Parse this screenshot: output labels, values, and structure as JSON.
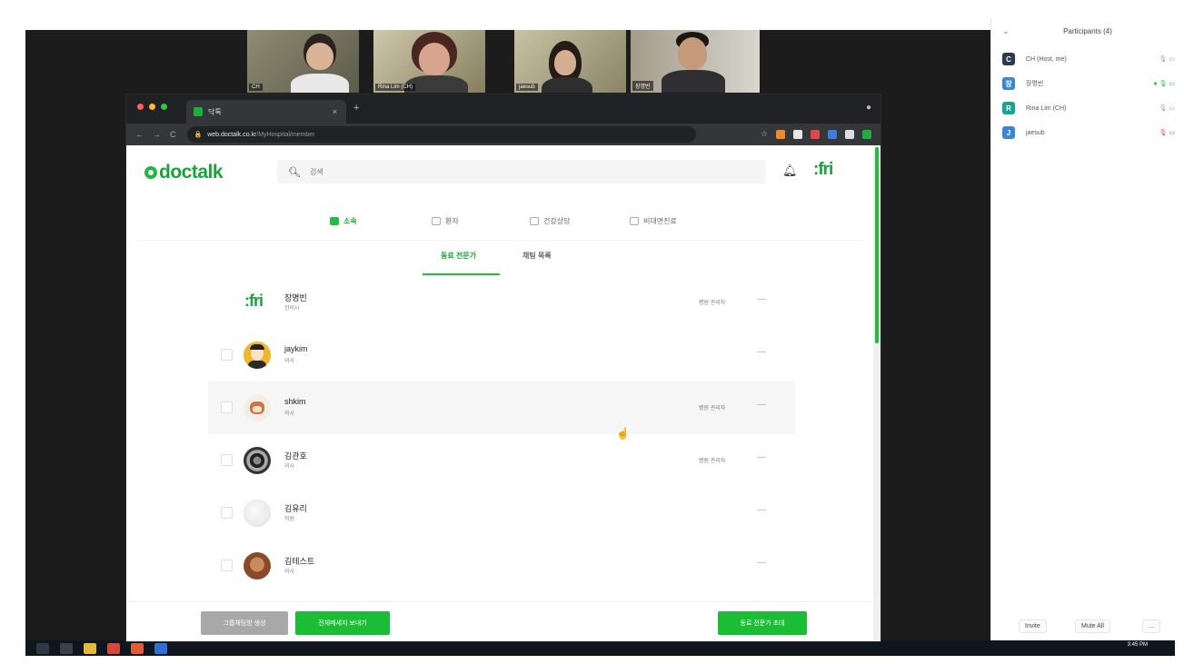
{
  "zoom": {
    "participants_title": "Participants (4)",
    "collapse_label": "⌄",
    "participants": [
      {
        "initial": "C",
        "name": "CH (Host, me)",
        "color": "#2c3a4f",
        "icons": "🎙 ▭"
      },
      {
        "initial": "장",
        "name": "장명빈",
        "color": "#3a86d6",
        "icons": "● 🎙 ▭"
      },
      {
        "initial": "R",
        "name": "Rina Lim (CH)",
        "color": "#1ba38f",
        "icons": "🎙 ▭"
      },
      {
        "initial": "J",
        "name": "jaesub",
        "color": "#3a86d6",
        "icons": "🎙 ▭"
      }
    ],
    "buttons": {
      "invite": "Invite",
      "mute_all": "Mute All",
      "more": "..."
    },
    "video_names": [
      "CH",
      "Rina Lim (CH)",
      "jaesub",
      "장명빈"
    ]
  },
  "browser": {
    "tab_title": "닥톡",
    "tab_close": "×",
    "new_tab": "+",
    "nav": {
      "back": "←",
      "forward": "→",
      "reload": "C"
    },
    "url_domain": "web.doctalk.co.kr",
    "url_path": "/MyHospital/member",
    "settings_glyph": "●"
  },
  "app": {
    "logo_text": "doctalk",
    "search_placeholder": "검색",
    "brand_text": ":fri",
    "gnb": [
      {
        "label": "소속",
        "active": true
      },
      {
        "label": "환자",
        "active": false
      },
      {
        "label": "건강상담",
        "active": false
      },
      {
        "label": "비대면진료",
        "active": false
      }
    ],
    "subtabs": [
      {
        "label": "동료 전문가",
        "active": true
      },
      {
        "label": "채팅 목록",
        "active": false
      }
    ],
    "members": [
      {
        "name": "장명빈",
        "role": "한의사",
        "tag": "병원 관리자",
        "has_check": false,
        "brand": ":fri"
      },
      {
        "name": "jaykim",
        "role": "의사",
        "tag": "",
        "has_check": true
      },
      {
        "name": "shkim",
        "role": "의사",
        "tag": "병원 관리자",
        "has_check": true
      },
      {
        "name": "김관호",
        "role": "의사",
        "tag": "병원 관리자",
        "has_check": true
      },
      {
        "name": "김유리",
        "role": "직원",
        "tag": "",
        "has_check": true
      },
      {
        "name": "김테스트",
        "role": "의사",
        "tag": "",
        "has_check": true
      }
    ],
    "more_glyph": "—",
    "footer": {
      "group_chat": "그룹채팅방 생성",
      "all_message": "전체메세지 보내기",
      "invite_colleague": "동료 전문가 초대"
    }
  },
  "taskbar": {
    "clock": "3:45 PM"
  },
  "colors": {
    "brand_green": "#1aa33a",
    "button_green": "#1bbd35"
  }
}
